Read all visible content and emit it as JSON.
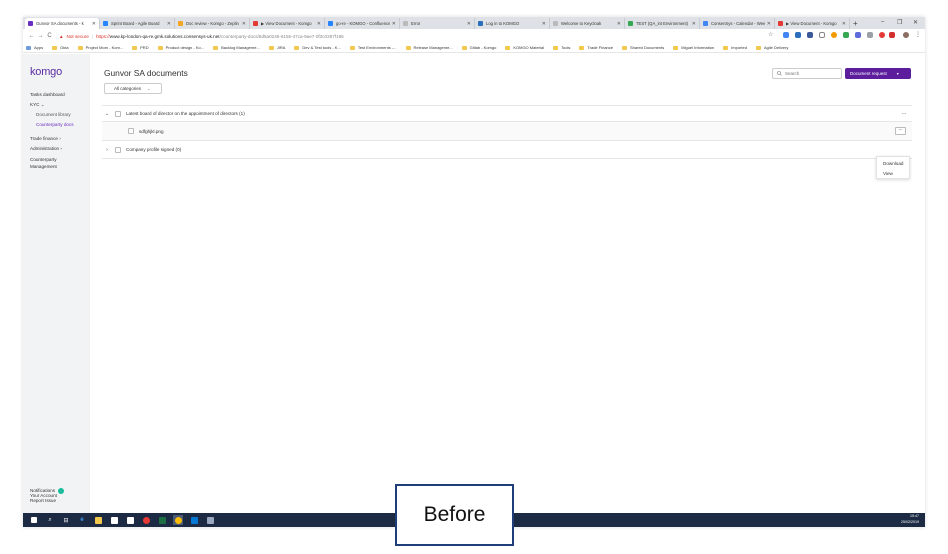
{
  "browser": {
    "tabs": [
      {
        "label": "Gunvor SA documents - k",
        "color": "#6a2fc2",
        "active": true
      },
      {
        "label": "Sprint Board - Agile Board",
        "color": "#2684ff",
        "active": false
      },
      {
        "label": "Doc review - Komgo - Zeplin",
        "color": "#f5a623",
        "active": false
      },
      {
        "label": "▶ View Document - Komgo",
        "color": "#e53935",
        "active": false
      },
      {
        "label": "go-re - KOMGO - Confluence",
        "color": "#2684ff",
        "active": false
      },
      {
        "label": "Error",
        "color": "#bbbbbb",
        "active": false
      },
      {
        "label": "Log in to KOMGO",
        "color": "#2a6ebb",
        "active": false
      },
      {
        "label": "Welcome to Keycloak",
        "color": "#bbbbbb",
        "active": false
      },
      {
        "label": "TEST (QA_int Environment)",
        "color": "#34a853",
        "active": false
      },
      {
        "label": "ConsenSys - Calendar - Week",
        "color": "#4285f4",
        "active": false
      },
      {
        "label": "▶ View Document - Komgo",
        "color": "#e53935",
        "active": false
      }
    ],
    "new_tab": "+",
    "window_controls": [
      "–",
      "❐",
      "✕"
    ],
    "nav": {
      "back": "←",
      "forward": "→",
      "reload": "C"
    },
    "security_label": "Not secure",
    "url_scheme": "https://",
    "url_host": "www.kp-london-qa-re.gmk.solutions.consensys-uk.net",
    "url_path": "/counterparty-docs/8d5a0245-6155-47ca-9ae7-0f3c0287f186",
    "bookmarks": [
      "Apps",
      "Okta",
      "Project Mom - Kom...",
      "PRD",
      "Product design - Ko...",
      "Backlog Manageme...",
      "JIRA",
      "Dev & Test tools - K...",
      "Test Environments -...",
      "Release Manageme...",
      "Gitlab - Komgo",
      "KOMGO Material",
      "Tools",
      "Trade Finance",
      "Shared Documents",
      "Miguel Information",
      "Imported",
      "Agile Delivery"
    ]
  },
  "sidebar": {
    "logo": "komgo",
    "items": [
      {
        "label": "Tasks dashboard",
        "level": 0,
        "active": false
      },
      {
        "label": "KYC ⌄",
        "level": 0,
        "active": false
      },
      {
        "label": "Document library",
        "level": 1,
        "active": false
      },
      {
        "label": "Counterparty docs",
        "level": 1,
        "active": true
      },
      {
        "label": "Trade finance  ›",
        "level": 0,
        "active": false
      },
      {
        "label": "Administration  ›",
        "level": 0,
        "active": false
      },
      {
        "label": "Counterparty",
        "level": 0,
        "active": false
      },
      {
        "label": "Management",
        "level": 0,
        "active": false
      }
    ],
    "footer": {
      "notifications": "Notifications",
      "report_issue": "Report Issue",
      "your_account": "Your Account"
    }
  },
  "main": {
    "title": "Gunvor SA documents",
    "filter_label": "All categories",
    "filter_chevron": "⌄",
    "search_placeholder": "Search",
    "search_icon": "magnifier",
    "doc_request_label": "Document request",
    "doc_request_caret": "▾",
    "groups": [
      {
        "label": "Latest board of director on the appointment of directors (1)",
        "expanded": true,
        "expander": "⌄",
        "more": "···"
      },
      {
        "label": "Company profile signed (0)",
        "expanded": false,
        "expander": "›",
        "more": ""
      }
    ],
    "files": [
      {
        "label": "sdfghjkl.png",
        "more": "···"
      }
    ],
    "context_menu": [
      "Download",
      "View"
    ]
  },
  "taskbar": {
    "time": "15:47",
    "date": "25/02/2019"
  },
  "overlay_label": "Before",
  "colors": {
    "brand": "#6a2fc2",
    "primary_button": "#5d1e9e",
    "sidebar_bg": "#f2f3f5",
    "taskbar_bg": "#1c2a44",
    "notification_badge": "#1abc9c"
  }
}
